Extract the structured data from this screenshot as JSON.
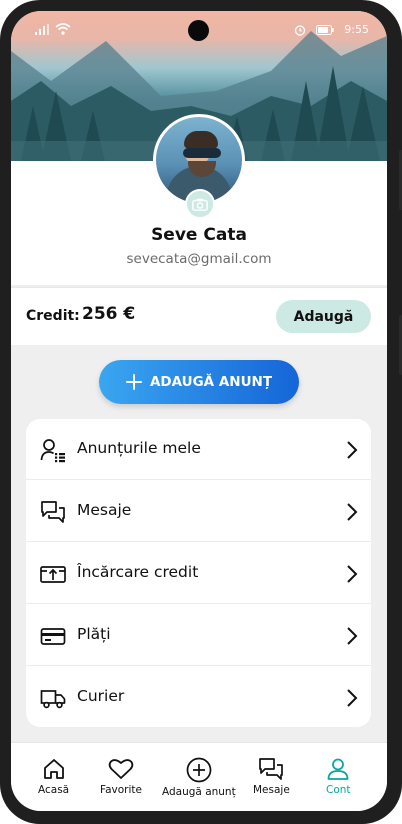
{
  "status_bar": {
    "time": "9:55"
  },
  "profile": {
    "name": "Seve Cata",
    "email": "sevecata@gmail.com"
  },
  "credit": {
    "label": "Credit:",
    "value": "256 €",
    "add_label": "Adaugă"
  },
  "post_button": {
    "label": "ADAUGĂ ANUNȚ"
  },
  "menu": {
    "items": [
      {
        "label": "Anunțurile mele",
        "icon": "user-list-icon"
      },
      {
        "label": "Mesaje",
        "icon": "chat-icon"
      },
      {
        "label": "Încărcare credit",
        "icon": "wallet-upload-icon"
      },
      {
        "label": "Plăți",
        "icon": "card-icon"
      },
      {
        "label": "Curier",
        "icon": "truck-icon"
      }
    ]
  },
  "tabbar": {
    "tabs": [
      {
        "label": "Acasă",
        "icon": "home-icon",
        "active": false
      },
      {
        "label": "Favorite",
        "icon": "heart-icon",
        "active": false
      },
      {
        "label": "Adaugă anunț",
        "icon": "plus-circle-icon",
        "active": false
      },
      {
        "label": "Mesaje",
        "icon": "chat-icon",
        "active": false
      },
      {
        "label": "Cont",
        "icon": "user-icon",
        "active": true
      }
    ]
  },
  "colors": {
    "accent": "#0aa6a0",
    "button_gradient_start": "#3aa6f0",
    "button_gradient_end": "#1565d8",
    "pill": "#cde9e4"
  }
}
